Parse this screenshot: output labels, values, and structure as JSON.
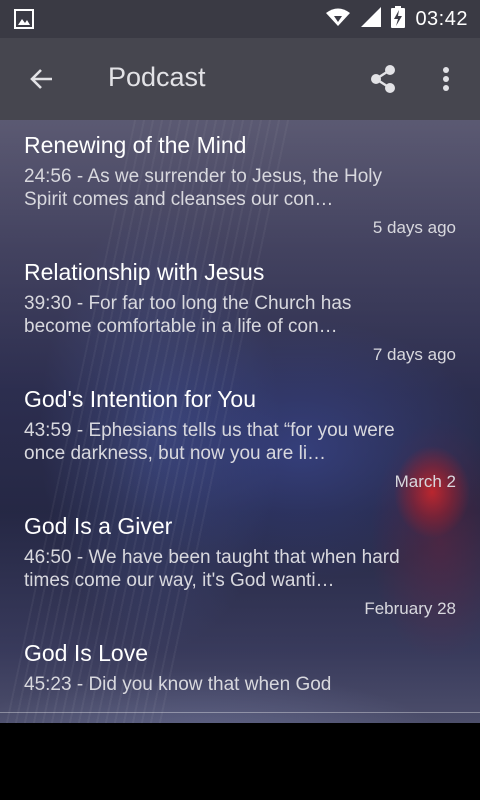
{
  "status": {
    "time": "03:42"
  },
  "app_bar": {
    "title": "Podcast"
  },
  "episodes": [
    {
      "title": "Renewing of the Mind",
      "duration": "24:56",
      "summary": "As we surrender to Jesus, the Holy Spirit comes and cleanses our con…",
      "date": "5 days ago"
    },
    {
      "title": "Relationship with Jesus",
      "duration": "39:30",
      "summary": "For far too long the Church has become comfortable in a life of con…",
      "date": "7 days ago"
    },
    {
      "title": "God's Intention for You",
      "duration": "43:59",
      "summary": "Ephesians tells us that “for you were once darkness, but now you are li…",
      "date": "March 2"
    },
    {
      "title": "God Is a Giver",
      "duration": "46:50",
      "summary": "We have been taught that when hard times come our way, it's God wanti…",
      "date": "February 28"
    },
    {
      "title": "God Is Love",
      "duration": "45:23",
      "summary": "Did you know that when God",
      "date": ""
    }
  ]
}
